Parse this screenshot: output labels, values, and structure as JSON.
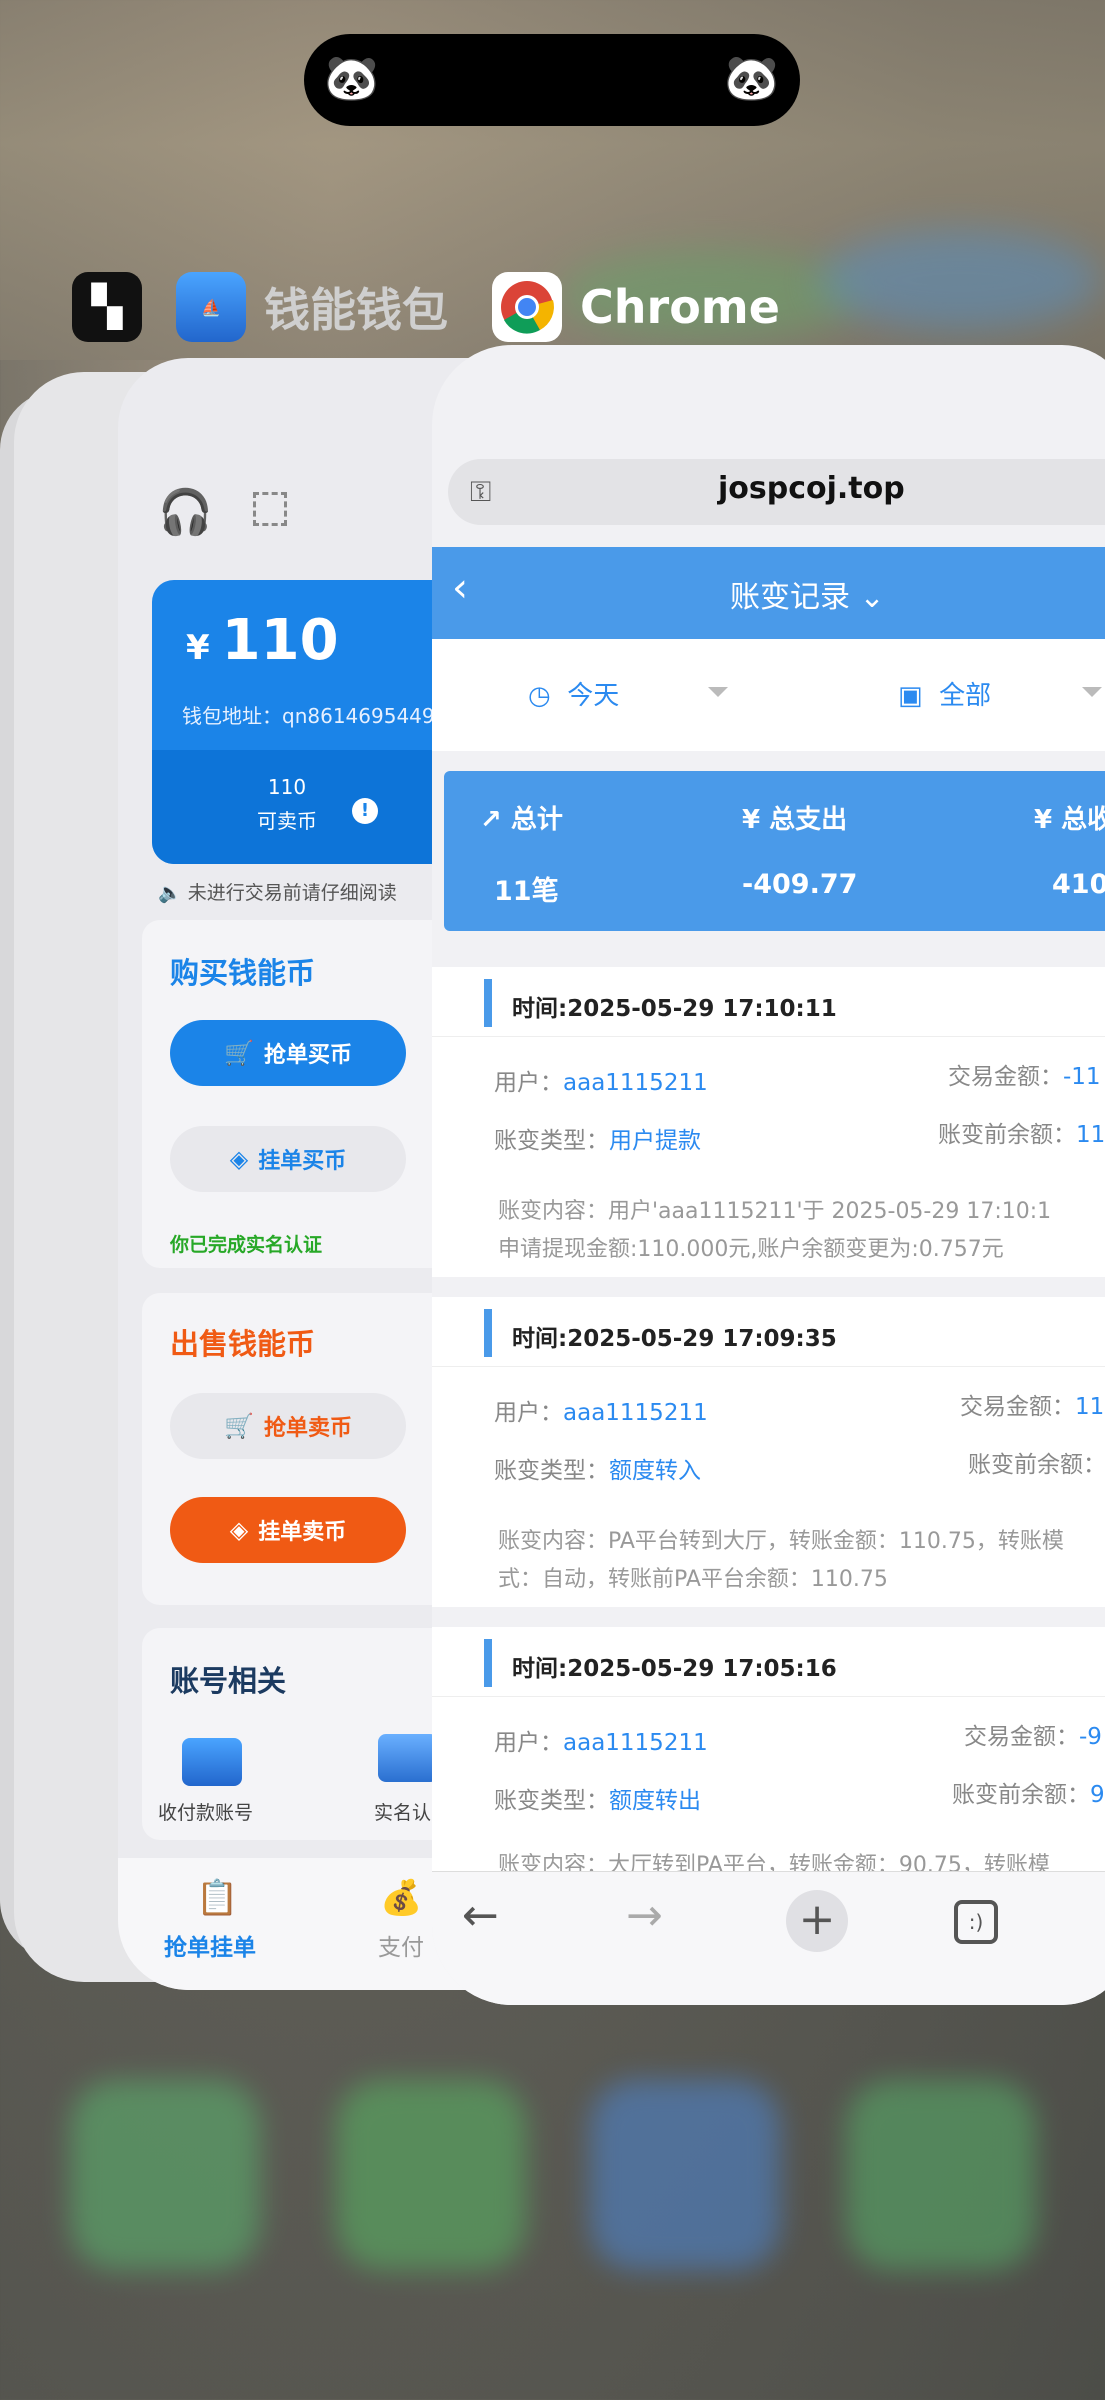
{
  "switcher": {
    "apps": [
      {
        "label": "",
        "icon": "qr-grid-icon"
      },
      {
        "label": "钱能钱包",
        "icon": "wallet-app-icon"
      },
      {
        "label": "Chrome",
        "icon": "chrome-icon"
      }
    ]
  },
  "wallet": {
    "balance_symbol": "¥",
    "balance": "110",
    "address": "钱包地址：qn8614695449",
    "sellable_value": "110",
    "sellable_label": "可卖币",
    "notice": "未进行交易前请仔细阅读",
    "buy": {
      "title": "购买钱能币",
      "grab_button": "抢单买币",
      "pending_button": "挂单买币",
      "verified": "你已完成实名认证"
    },
    "sell": {
      "title": "出售钱能币",
      "grab_button": "抢单卖币",
      "pending_button": "挂单卖币"
    },
    "account": {
      "title": "账号相关",
      "item1": "收付款账号",
      "item2": "实名认"
    },
    "tabs": {
      "tab1": "抢单挂单",
      "tab2": "支付"
    }
  },
  "chrome": {
    "url": "jospcoj.top",
    "page_title": "账变记录",
    "filter_date": "今天",
    "filter_type": "全部",
    "summary": {
      "total_label": "总计",
      "total_value": "11笔",
      "out_label": "总支出",
      "out_value": "-409.77",
      "in_label": "总收",
      "in_value": "410."
    },
    "records": [
      {
        "time": "时间:2025-05-29 17:10:11",
        "user_label": "用户：",
        "user": "aaa1115211",
        "amount_label": "交易金额：",
        "amount": "-11",
        "type_label": "账变类型：",
        "type": "用户提款",
        "before_label": "账变前余额：",
        "before": "11",
        "content1": "账变内容：用户'aaa1115211'于 2025-05-29 17:10:1",
        "content2": "申请提现金额:110.000元,账户余额变更为:0.757元"
      },
      {
        "time": "时间:2025-05-29 17:09:35",
        "user_label": "用户：",
        "user": "aaa1115211",
        "amount_label": "交易金额：",
        "amount": "11",
        "type_label": "账变类型：",
        "type": "额度转入",
        "before_label": "账变前余额：",
        "before": "",
        "content1": "账变内容：PA平台转到大厅，转账金额：110.75，转账模",
        "content2": "式：自动，转账前PA平台余额：110.75"
      },
      {
        "time": "时间:2025-05-29 17:05:16",
        "user_label": "用户：",
        "user": "aaa1115211",
        "amount_label": "交易金额：",
        "amount": "-9",
        "type_label": "账变类型：",
        "type": "额度转出",
        "before_label": "账变前余额：",
        "before": "9",
        "content1": "账变内容：大厅转到PA平台，转账金额：90.75，转账模",
        "content2": ""
      }
    ]
  }
}
